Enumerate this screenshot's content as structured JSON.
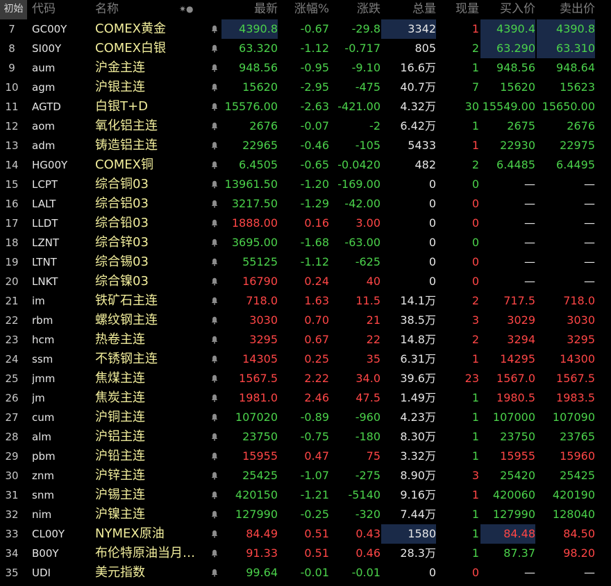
{
  "header": {
    "tag": "初始",
    "code": "代码",
    "name": "名称",
    "sort_icon": "✷●",
    "last": "最新",
    "pct": "涨幅%",
    "chg": "涨跌",
    "vol": "总量",
    "cur": "现量",
    "bid": "买入价",
    "ask": "卖出价"
  },
  "colors": {
    "up": "#ff4646",
    "down": "#4bd24b",
    "flat": "#e6e6e6",
    "name": "#f2ee9c",
    "highlight": "#1a2a48"
  },
  "rows": [
    {
      "idx": "7",
      "code": "GC00Y",
      "name": "COMEX黄金",
      "last": "4390.8",
      "pct": "-0.67",
      "chg": "-29.8",
      "vol": "3342",
      "cur": "1",
      "bid": "4390.4",
      "ask": "4390.8",
      "dir": "dn",
      "cur_dir": "up",
      "bid_dir": "dn",
      "ask_dir": "dn",
      "hl": [
        "last",
        "vol",
        "bid",
        "ask"
      ]
    },
    {
      "idx": "8",
      "code": "SI00Y",
      "name": "COMEX白银",
      "last": "63.320",
      "pct": "-1.12",
      "chg": "-0.717",
      "vol": "805",
      "cur": "2",
      "bid": "63.290",
      "ask": "63.310",
      "dir": "dn",
      "cur_dir": "dn",
      "bid_dir": "dn",
      "ask_dir": "dn",
      "hl": [
        "bid",
        "ask"
      ]
    },
    {
      "idx": "9",
      "code": "aum",
      "name": "沪金主连",
      "last": "948.56",
      "pct": "-0.95",
      "chg": "-9.10",
      "vol": "16.6万",
      "cur": "1",
      "bid": "948.56",
      "ask": "948.64",
      "dir": "dn",
      "cur_dir": "dn",
      "bid_dir": "dn",
      "ask_dir": "dn",
      "hl": []
    },
    {
      "idx": "10",
      "code": "agm",
      "name": "沪银主连",
      "last": "15620",
      "pct": "-2.95",
      "chg": "-475",
      "vol": "40.7万",
      "cur": "7",
      "bid": "15620",
      "ask": "15623",
      "dir": "dn",
      "cur_dir": "dn",
      "bid_dir": "dn",
      "ask_dir": "dn",
      "hl": []
    },
    {
      "idx": "11",
      "code": "AGTD",
      "name": "白银T+D",
      "last": "15576.00",
      "pct": "-2.63",
      "chg": "-421.00",
      "vol": "4.32万",
      "cur": "30",
      "bid": "15549.00",
      "ask": "15650.00",
      "dir": "dn",
      "cur_dir": "dn",
      "bid_dir": "dn",
      "ask_dir": "dn",
      "hl": []
    },
    {
      "idx": "12",
      "code": "aom",
      "name": "氧化铝主连",
      "last": "2676",
      "pct": "-0.07",
      "chg": "-2",
      "vol": "6.42万",
      "cur": "1",
      "bid": "2675",
      "ask": "2676",
      "dir": "dn",
      "cur_dir": "dn",
      "bid_dir": "dn",
      "ask_dir": "dn",
      "hl": []
    },
    {
      "idx": "13",
      "code": "adm",
      "name": "铸造铝主连",
      "last": "22965",
      "pct": "-0.46",
      "chg": "-105",
      "vol": "5433",
      "cur": "1",
      "bid": "22930",
      "ask": "22975",
      "dir": "dn",
      "cur_dir": "up",
      "bid_dir": "dn",
      "ask_dir": "dn",
      "hl": []
    },
    {
      "idx": "14",
      "code": "HG00Y",
      "name": "COMEX铜",
      "last": "6.4505",
      "pct": "-0.65",
      "chg": "-0.0420",
      "vol": "482",
      "cur": "2",
      "bid": "6.4485",
      "ask": "6.4495",
      "dir": "dn",
      "cur_dir": "dn",
      "bid_dir": "dn",
      "ask_dir": "dn",
      "hl": []
    },
    {
      "idx": "15",
      "code": "LCPT",
      "name": "综合铜03",
      "last": "13961.50",
      "pct": "-1.20",
      "chg": "-169.00",
      "vol": "0",
      "cur": "0",
      "bid": "—",
      "ask": "—",
      "dir": "dn",
      "cur_dir": "dn",
      "bid_dir": "fl",
      "ask_dir": "fl",
      "hl": []
    },
    {
      "idx": "16",
      "code": "LALT",
      "name": "综合铝03",
      "last": "3217.50",
      "pct": "-1.29",
      "chg": "-42.00",
      "vol": "0",
      "cur": "0",
      "bid": "—",
      "ask": "—",
      "dir": "dn",
      "cur_dir": "up",
      "bid_dir": "fl",
      "ask_dir": "fl",
      "hl": []
    },
    {
      "idx": "17",
      "code": "LLDT",
      "name": "综合铅03",
      "last": "1888.00",
      "pct": "0.16",
      "chg": "3.00",
      "vol": "0",
      "cur": "0",
      "bid": "—",
      "ask": "—",
      "dir": "up",
      "cur_dir": "up",
      "bid_dir": "fl",
      "ask_dir": "fl",
      "hl": []
    },
    {
      "idx": "18",
      "code": "LZNT",
      "name": "综合锌03",
      "last": "3695.00",
      "pct": "-1.68",
      "chg": "-63.00",
      "vol": "0",
      "cur": "0",
      "bid": "—",
      "ask": "—",
      "dir": "dn",
      "cur_dir": "dn",
      "bid_dir": "fl",
      "ask_dir": "fl",
      "hl": []
    },
    {
      "idx": "19",
      "code": "LTNT",
      "name": "综合锡03",
      "last": "55125",
      "pct": "-1.12",
      "chg": "-625",
      "vol": "0",
      "cur": "0",
      "bid": "—",
      "ask": "—",
      "dir": "dn",
      "cur_dir": "up",
      "bid_dir": "fl",
      "ask_dir": "fl",
      "hl": []
    },
    {
      "idx": "20",
      "code": "LNKT",
      "name": "综合镍03",
      "last": "16790",
      "pct": "0.24",
      "chg": "40",
      "vol": "0",
      "cur": "0",
      "bid": "—",
      "ask": "—",
      "dir": "up",
      "cur_dir": "up",
      "bid_dir": "fl",
      "ask_dir": "fl",
      "hl": []
    },
    {
      "idx": "21",
      "code": "im",
      "name": "铁矿石主连",
      "last": "718.0",
      "pct": "1.63",
      "chg": "11.5",
      "vol": "14.1万",
      "cur": "2",
      "bid": "717.5",
      "ask": "718.0",
      "dir": "up",
      "cur_dir": "up",
      "bid_dir": "up",
      "ask_dir": "up",
      "hl": []
    },
    {
      "idx": "22",
      "code": "rbm",
      "name": "螺纹钢主连",
      "last": "3030",
      "pct": "0.70",
      "chg": "21",
      "vol": "38.5万",
      "cur": "3",
      "bid": "3029",
      "ask": "3030",
      "dir": "up",
      "cur_dir": "up",
      "bid_dir": "up",
      "ask_dir": "up",
      "hl": []
    },
    {
      "idx": "23",
      "code": "hcm",
      "name": "热卷主连",
      "last": "3295",
      "pct": "0.67",
      "chg": "22",
      "vol": "14.8万",
      "cur": "2",
      "bid": "3294",
      "ask": "3295",
      "dir": "up",
      "cur_dir": "up",
      "bid_dir": "up",
      "ask_dir": "up",
      "hl": []
    },
    {
      "idx": "24",
      "code": "ssm",
      "name": "不锈钢主连",
      "last": "14305",
      "pct": "0.25",
      "chg": "35",
      "vol": "6.31万",
      "cur": "1",
      "bid": "14295",
      "ask": "14300",
      "dir": "up",
      "cur_dir": "up",
      "bid_dir": "up",
      "ask_dir": "up",
      "hl": []
    },
    {
      "idx": "25",
      "code": "jmm",
      "name": "焦煤主连",
      "last": "1567.5",
      "pct": "2.22",
      "chg": "34.0",
      "vol": "39.6万",
      "cur": "23",
      "bid": "1567.0",
      "ask": "1567.5",
      "dir": "up",
      "cur_dir": "up",
      "bid_dir": "up",
      "ask_dir": "up",
      "hl": []
    },
    {
      "idx": "26",
      "code": "jm",
      "name": "焦炭主连",
      "last": "1981.0",
      "pct": "2.46",
      "chg": "47.5",
      "vol": "1.49万",
      "cur": "1",
      "bid": "1980.5",
      "ask": "1983.5",
      "dir": "up",
      "cur_dir": "dn",
      "bid_dir": "up",
      "ask_dir": "up",
      "hl": []
    },
    {
      "idx": "27",
      "code": "cum",
      "name": "沪铜主连",
      "last": "107020",
      "pct": "-0.89",
      "chg": "-960",
      "vol": "4.23万",
      "cur": "1",
      "bid": "107000",
      "ask": "107090",
      "dir": "dn",
      "cur_dir": "dn",
      "bid_dir": "dn",
      "ask_dir": "dn",
      "hl": []
    },
    {
      "idx": "28",
      "code": "alm",
      "name": "沪铝主连",
      "last": "23750",
      "pct": "-0.75",
      "chg": "-180",
      "vol": "8.30万",
      "cur": "1",
      "bid": "23750",
      "ask": "23765",
      "dir": "dn",
      "cur_dir": "dn",
      "bid_dir": "dn",
      "ask_dir": "dn",
      "hl": []
    },
    {
      "idx": "29",
      "code": "pbm",
      "name": "沪铅主连",
      "last": "15955",
      "pct": "0.47",
      "chg": "75",
      "vol": "3.32万",
      "cur": "1",
      "bid": "15955",
      "ask": "15960",
      "dir": "up",
      "cur_dir": "dn",
      "bid_dir": "up",
      "ask_dir": "up",
      "hl": []
    },
    {
      "idx": "30",
      "code": "znm",
      "name": "沪锌主连",
      "last": "25425",
      "pct": "-1.07",
      "chg": "-275",
      "vol": "8.90万",
      "cur": "3",
      "bid": "25420",
      "ask": "25425",
      "dir": "dn",
      "cur_dir": "up",
      "bid_dir": "dn",
      "ask_dir": "dn",
      "hl": []
    },
    {
      "idx": "31",
      "code": "snm",
      "name": "沪锡主连",
      "last": "420150",
      "pct": "-1.21",
      "chg": "-5140",
      "vol": "9.16万",
      "cur": "1",
      "bid": "420060",
      "ask": "420190",
      "dir": "dn",
      "cur_dir": "up",
      "bid_dir": "dn",
      "ask_dir": "dn",
      "hl": []
    },
    {
      "idx": "32",
      "code": "nim",
      "name": "沪镍主连",
      "last": "127990",
      "pct": "-0.25",
      "chg": "-320",
      "vol": "7.44万",
      "cur": "1",
      "bid": "127990",
      "ask": "128040",
      "dir": "dn",
      "cur_dir": "dn",
      "bid_dir": "dn",
      "ask_dir": "dn",
      "hl": []
    },
    {
      "idx": "33",
      "code": "CL00Y",
      "name": "NYMEX原油",
      "last": "84.49",
      "pct": "0.51",
      "chg": "0.43",
      "vol": "1580",
      "cur": "1",
      "bid": "84.48",
      "ask": "84.50",
      "dir": "up",
      "cur_dir": "dn",
      "bid_dir": "up",
      "ask_dir": "up",
      "hl": [
        "vol",
        "bid"
      ]
    },
    {
      "idx": "34",
      "code": "B00Y",
      "name": "布伦特原油当月…",
      "last": "91.33",
      "pct": "0.51",
      "chg": "0.46",
      "vol": "28.3万",
      "cur": "1",
      "bid": "87.37",
      "ask": "98.20",
      "dir": "up",
      "cur_dir": "dn",
      "bid_dir": "dn",
      "ask_dir": "up",
      "hl": []
    },
    {
      "idx": "35",
      "code": "UDI",
      "name": "美元指数",
      "last": "99.64",
      "pct": "-0.01",
      "chg": "-0.01",
      "vol": "0",
      "cur": "0",
      "bid": "—",
      "ask": "—",
      "dir": "dn",
      "cur_dir": "up",
      "bid_dir": "fl",
      "ask_dir": "fl",
      "hl": []
    }
  ]
}
